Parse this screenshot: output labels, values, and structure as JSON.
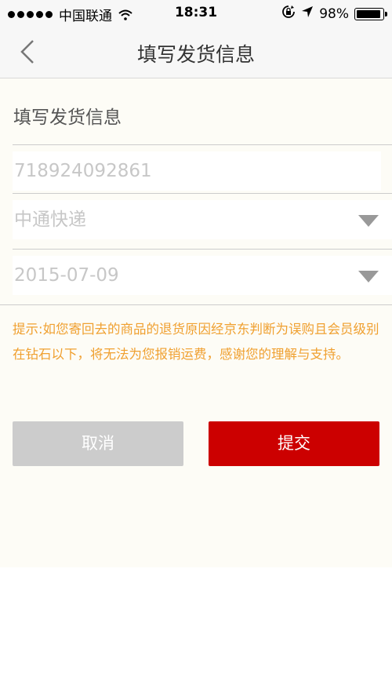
{
  "status_bar": {
    "carrier": "中国联通",
    "time": "18:31",
    "battery": "98%"
  },
  "nav": {
    "title": "填写发货信息"
  },
  "form": {
    "section_title": "填写发货信息",
    "tracking_number": "718924092861",
    "courier": "中通快递",
    "date": "2015-07-09"
  },
  "tip": "提示:如您寄回去的商品的退货原因经京东判断为误购且会员级别在钻石以下，将无法为您报销运费，感谢您的理解与支持。",
  "buttons": {
    "cancel": "取消",
    "submit": "提交"
  },
  "colors": {
    "accent": "#cc0000",
    "tip": "#f0a030",
    "background": "#fdfcf6"
  }
}
